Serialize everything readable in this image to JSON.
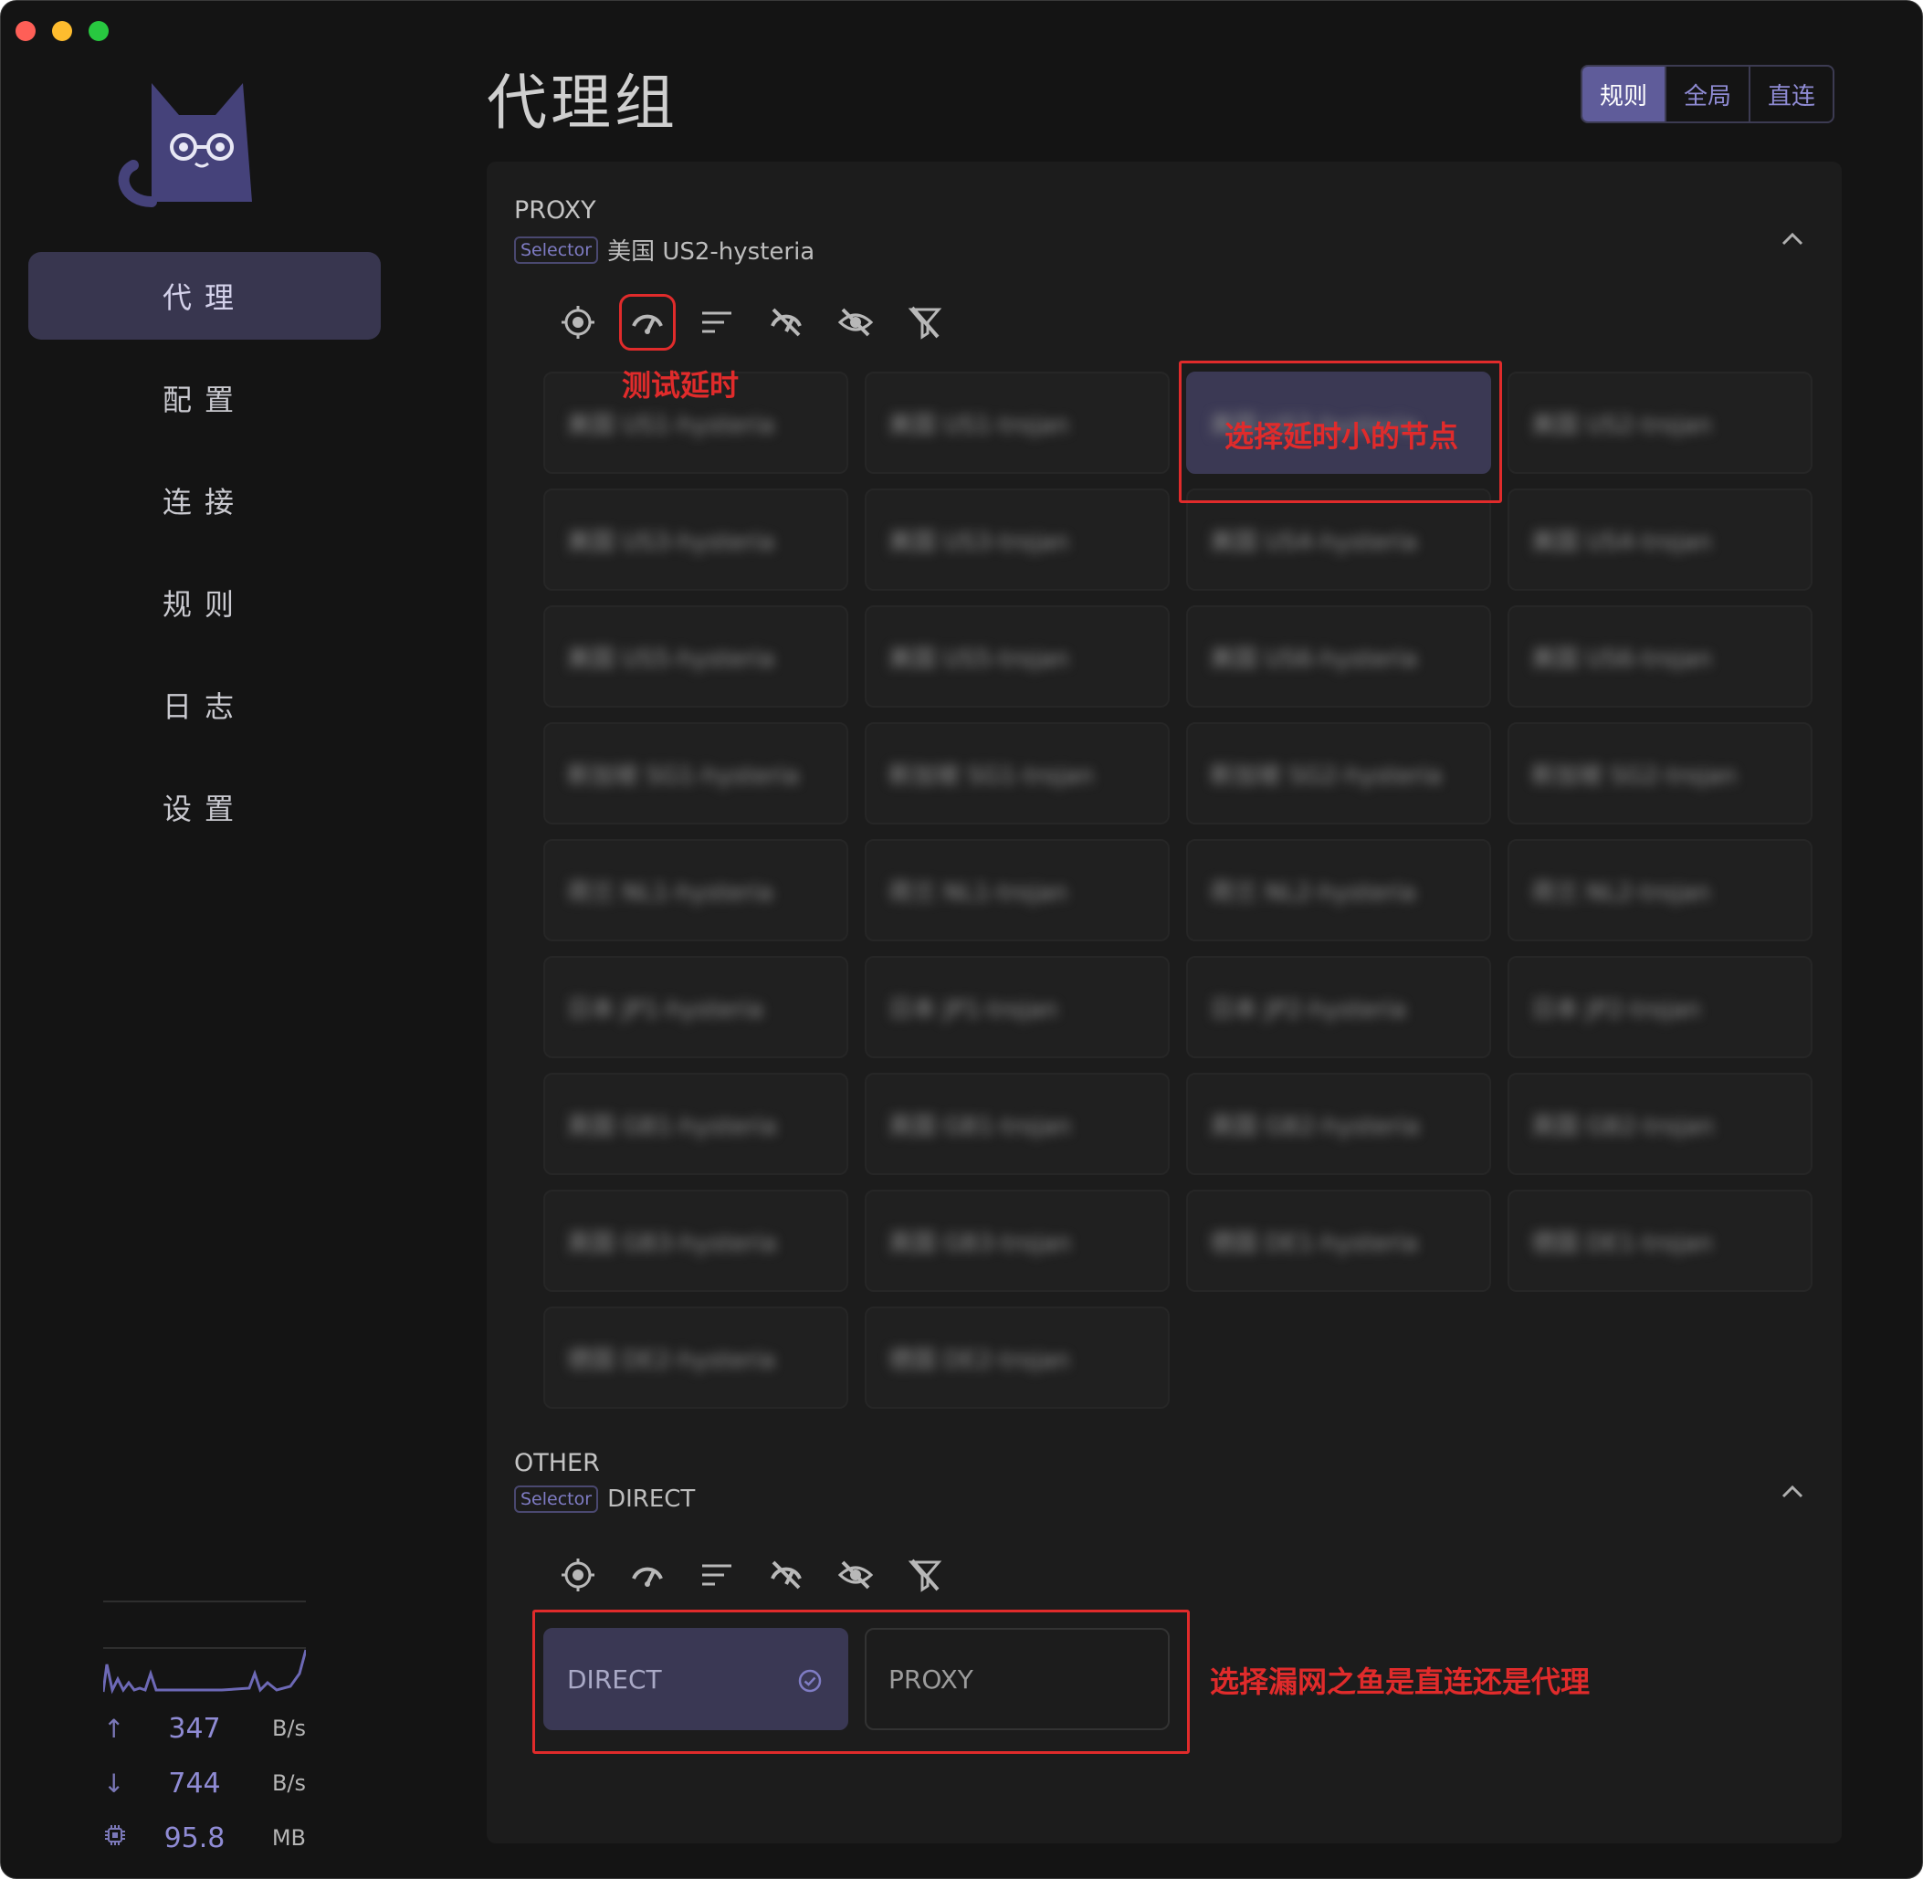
{
  "colors": {
    "accent": "#5f5c9a",
    "annotation": "#e02b2b",
    "background": "#141414",
    "panel": "#1c1c1c"
  },
  "sidebar": {
    "items": [
      {
        "label": "代理",
        "active": true
      },
      {
        "label": "配置"
      },
      {
        "label": "连接"
      },
      {
        "label": "规则"
      },
      {
        "label": "日志"
      },
      {
        "label": "设置"
      }
    ],
    "stats": {
      "upload": {
        "value": "347",
        "unit": "B/s"
      },
      "download": {
        "value": "744",
        "unit": "B/s"
      },
      "memory": {
        "value": "95.8",
        "unit": "MB"
      }
    }
  },
  "main": {
    "title": "代理组",
    "modes": [
      "规则",
      "全局",
      "直连"
    ],
    "active_mode": "规则"
  },
  "groups": [
    {
      "name": "PROXY",
      "type": "Selector",
      "selected": "美国 US2-hysteria",
      "nodes": [
        "美国 US1-hysteria",
        "美国 US1-trojan",
        "美国 US2-hysteria",
        "美国 US2-trojan",
        "美国 US3-hysteria",
        "美国 US3-trojan",
        "美国 US4-hysteria",
        "美国 US4-trojan",
        "美国 US5-hysteria",
        "美国 US5-trojan",
        "美国 US6-hysteria",
        "美国 US6-trojan",
        "新加坡 SG1-hysteria",
        "新加坡 SG1-trojan",
        "新加坡 SG2-hysteria",
        "新加坡 SG2-trojan",
        "荷兰 NL1-hysteria",
        "荷兰 NL1-trojan",
        "荷兰 NL2-hysteria",
        "荷兰 NL2-trojan",
        "日本 JP1-hysteria",
        "日本 JP1-trojan",
        "日本 JP2-hysteria",
        "日本 JP2-trojan",
        "英国 GB1-hysteria",
        "英国 GB1-trojan",
        "英国 GB2-hysteria",
        "英国 GB2-trojan",
        "英国 GB3-hysteria",
        "英国 GB3-trojan",
        "德国 DE1-hysteria",
        "德国 DE1-trojan",
        "德国 DE2-hysteria",
        "德国 DE2-trojan"
      ]
    },
    {
      "name": "OTHER",
      "type": "Selector",
      "selected": "DIRECT",
      "nodes": [
        "DIRECT",
        "PROXY"
      ]
    }
  ],
  "annotations": {
    "test_latency": "测试延时",
    "choose_node": "选择延时小的节点",
    "choose_other": "选择漏网之鱼是直连还是代理"
  },
  "icons": [
    "locate-icon",
    "latency-test-icon",
    "sort-icon",
    "hide-unavailable-icon",
    "hide-icon",
    "filter-off-icon",
    "collapse-icon",
    "check-circle-icon"
  ]
}
